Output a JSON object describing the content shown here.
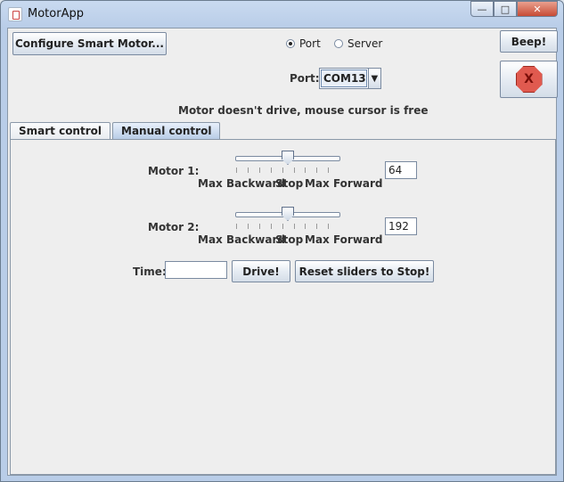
{
  "window": {
    "title": "MotorApp",
    "min_glyph": "—",
    "max_glyph": "□",
    "close_glyph": "✕"
  },
  "top": {
    "configure_button": "Configure Smart Motor...",
    "connection": {
      "port_label": "Port",
      "server_label": "Server",
      "selected": "Port"
    },
    "beep_button": "Beep!",
    "stop_glyph": "X",
    "port_field_label": "Port:",
    "port_value": "COM13",
    "status": "Motor doesn't drive, mouse cursor is free"
  },
  "tabs": [
    {
      "label": "Smart control",
      "active": false
    },
    {
      "label": "Manual control",
      "active": true
    }
  ],
  "manual": {
    "motor1": {
      "label": "Motor 1:",
      "value": "64",
      "level": 0.5
    },
    "motor2": {
      "label": "Motor 2:",
      "value": "192",
      "level": 0.5
    },
    "scale_left": "Max Backward",
    "scale_mid": "Stop",
    "scale_right": "Max Forward",
    "time_label": "Time:",
    "time_value": "",
    "drive_button": "Drive!",
    "reset_button": "Reset sliders to Stop!"
  },
  "icons": {
    "app": "java-cup-icon",
    "stop": "stop-sign-icon",
    "combo": "chevron-down-icon"
  }
}
